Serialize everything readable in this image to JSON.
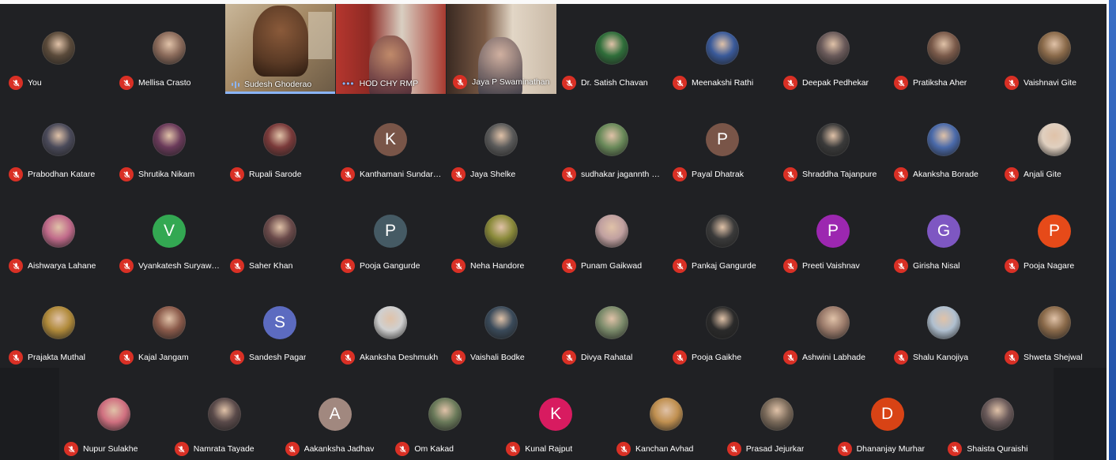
{
  "colors": {
    "background": "#202124",
    "muted_mic": "#d93025",
    "speaking_accent": "#8ab4f8"
  },
  "video_tiles": [
    {
      "name": "Sudesh Ghoderao",
      "indicator": "speaking-waves-icon"
    },
    {
      "name": "HOD CHY RMP",
      "indicator": "more-dots-icon"
    },
    {
      "name": "Jaya P Swaminathan",
      "indicator": "mic-off-icon"
    }
  ],
  "rows": [
    [
      {
        "name": "You",
        "avatar": "photo",
        "color": "#5a4a3a"
      },
      {
        "name": "Mellisa Crasto",
        "avatar": "photo",
        "color": "#8a6a5a"
      },
      {
        "name": "Dr. Satish Chavan",
        "avatar": "photo",
        "color": "#2f6e3a"
      },
      {
        "name": "Meenakshi Rathi",
        "avatar": "photo",
        "color": "#3a5a9a"
      },
      {
        "name": "Deepak Pedhekar",
        "avatar": "photo",
        "color": "#6a5a5a"
      },
      {
        "name": "Pratiksha Aher",
        "avatar": "photo",
        "color": "#7a5a4a"
      },
      {
        "name": "Vaishnavi Gite",
        "avatar": "photo",
        "color": "#8a6a4a"
      }
    ],
    [
      {
        "name": "Prabodhan Katare",
        "avatar": "photo",
        "color": "#4a4a5a"
      },
      {
        "name": "Shrutika Nikam",
        "avatar": "photo",
        "color": "#6a3a5a"
      },
      {
        "name": "Rupali Sarode",
        "avatar": "photo",
        "color": "#7a3a3a"
      },
      {
        "name": "Kanthamani Sundara...",
        "avatar": "initial",
        "initial": "K",
        "color": "#795548"
      },
      {
        "name": "Jaya Shelke",
        "avatar": "photo",
        "color": "#5a5a5a"
      },
      {
        "name": "sudhakar jagannth B...",
        "avatar": "photo",
        "color": "#6a8a5a"
      },
      {
        "name": "Payal Dhatrak",
        "avatar": "initial",
        "initial": "P",
        "color": "#795548"
      },
      {
        "name": "Shraddha Tajanpure",
        "avatar": "photo",
        "color": "#3a3a3a"
      },
      {
        "name": "Akanksha Borade",
        "avatar": "photo",
        "color": "#4a6aaa"
      },
      {
        "name": "Anjali Gite",
        "avatar": "photo",
        "color": "#e0d0c0"
      }
    ],
    [
      {
        "name": "Aishwarya Lahane",
        "avatar": "photo",
        "color": "#c06a8a"
      },
      {
        "name": "Vyankatesh Suryawa...",
        "avatar": "initial",
        "initial": "V",
        "color": "#33a852"
      },
      {
        "name": "Saher Khan",
        "avatar": "photo",
        "color": "#6a4a4a"
      },
      {
        "name": "Pooja Gangurde",
        "avatar": "initial",
        "initial": "P",
        "color": "#455a64"
      },
      {
        "name": "Neha Handore",
        "avatar": "photo",
        "color": "#8a8a3a"
      },
      {
        "name": "Punam Gaikwad",
        "avatar": "photo",
        "color": "#c0a0a0"
      },
      {
        "name": "Pankaj Gangurde",
        "avatar": "photo",
        "color": "#3a3a3a"
      },
      {
        "name": "Preeti Vaishnav",
        "avatar": "initial",
        "initial": "P",
        "color": "#9c27b0"
      },
      {
        "name": "Girisha Nisal",
        "avatar": "initial",
        "initial": "G",
        "color": "#7e57c2"
      },
      {
        "name": "Pooja Nagare",
        "avatar": "initial",
        "initial": "P",
        "color": "#e64a19"
      }
    ],
    [
      {
        "name": "Prajakta Muthal",
        "avatar": "photo",
        "color": "#b08a3a"
      },
      {
        "name": "Kajal Jangam",
        "avatar": "photo",
        "color": "#8a5a4a"
      },
      {
        "name": "Sandesh Pagar",
        "avatar": "initial",
        "initial": "S",
        "color": "#5c6bc0"
      },
      {
        "name": "Akanksha Deshmukh",
        "avatar": "photo",
        "color": "#d0d0d0"
      },
      {
        "name": "Vaishali Bodke",
        "avatar": "photo",
        "color": "#3a4a5a"
      },
      {
        "name": "Divya Rahatal",
        "avatar": "photo",
        "color": "#7a8a6a"
      },
      {
        "name": "Pooja Gaikhe",
        "avatar": "photo",
        "color": "#2a2a2a"
      },
      {
        "name": "Ashwini Labhade",
        "avatar": "photo",
        "color": "#9a7a6a"
      },
      {
        "name": "Shalu Kanojiya",
        "avatar": "photo",
        "color": "#b0c0d0"
      },
      {
        "name": "Shweta Shejwal",
        "avatar": "photo",
        "color": "#8a6a4a"
      }
    ],
    [
      {
        "name": "Nupur Sulakhe",
        "avatar": "photo",
        "color": "#d07080"
      },
      {
        "name": "Namrata Tayade",
        "avatar": "photo",
        "color": "#5a4a4a"
      },
      {
        "name": "Aakanksha Jadhav",
        "avatar": "initial",
        "initial": "A",
        "color": "#a1887f"
      },
      {
        "name": "Om Kakad",
        "avatar": "photo",
        "color": "#6a7a5a"
      },
      {
        "name": "Kunal Rajput",
        "avatar": "initial",
        "initial": "K",
        "color": "#d81b60"
      },
      {
        "name": "Kanchan Avhad",
        "avatar": "photo",
        "color": "#c09050"
      },
      {
        "name": "Prasad Jejurkar",
        "avatar": "photo",
        "color": "#7a6a5a"
      },
      {
        "name": "Dhananjay Murhar",
        "avatar": "initial",
        "initial": "D",
        "color": "#d84315"
      },
      {
        "name": "Shaista Quraishi",
        "avatar": "photo",
        "color": "#6a5a5a"
      }
    ]
  ]
}
